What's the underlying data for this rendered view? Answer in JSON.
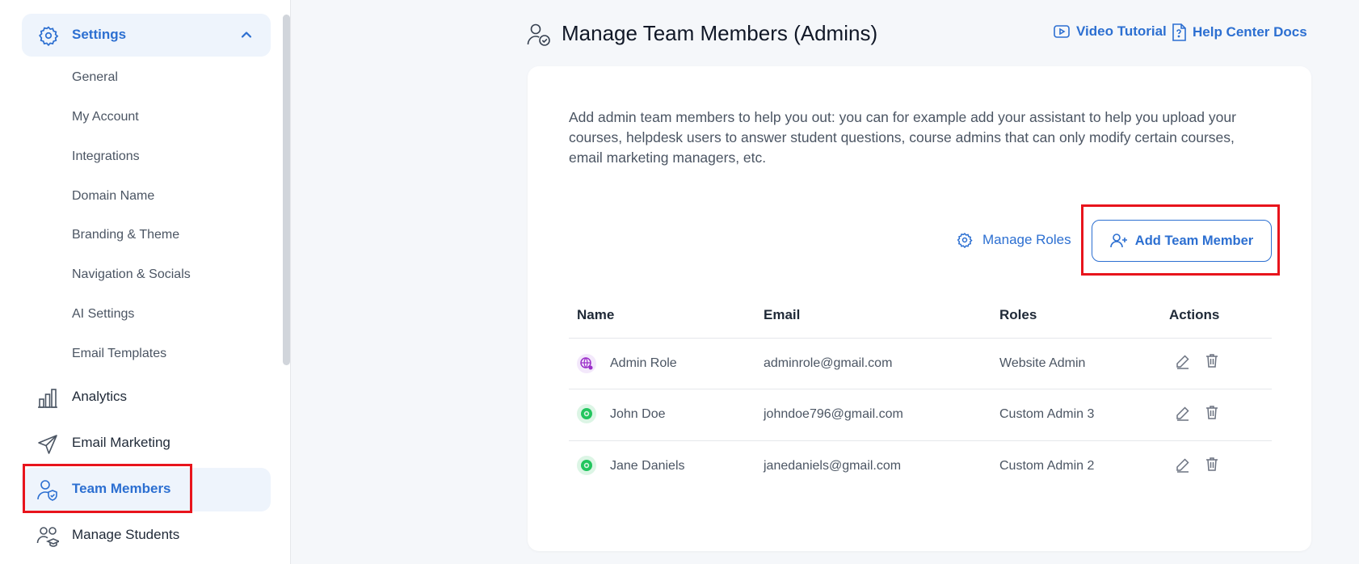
{
  "sidebar": {
    "settings_label": "Settings",
    "sub_items": [
      "General",
      "My Account",
      "Integrations",
      "Domain Name",
      "Branding & Theme",
      "Navigation & Socials",
      "AI Settings",
      "Email Templates"
    ],
    "nav": {
      "analytics": "Analytics",
      "email_marketing": "Email Marketing",
      "team_members": "Team Members",
      "manage_students": "Manage Students"
    }
  },
  "header": {
    "title": "Manage Team Members (Admins)",
    "video_tutorial": "Video Tutorial",
    "help_center": "Help Center Docs"
  },
  "main": {
    "description": "Add admin team members to help you out: you can for example add your assistant to help you upload your courses, helpdesk users to answer student questions, course admins that can only modify certain courses, email marketing managers, etc.",
    "manage_roles": "Manage Roles",
    "add_member": "Add Team Member",
    "columns": {
      "name": "Name",
      "email": "Email",
      "roles": "Roles",
      "actions": "Actions"
    },
    "rows": [
      {
        "name": "Admin Role",
        "email": "adminrole@gmail.com",
        "role": "Website Admin",
        "avatar": "globe-icon"
      },
      {
        "name": "John Doe",
        "email": "johndoe796@gmail.com",
        "role": "Custom Admin 3",
        "avatar": "gear-icon"
      },
      {
        "name": "Jane Daniels",
        "email": "janedaniels@gmail.com",
        "role": "Custom Admin 2",
        "avatar": "gear-icon"
      }
    ]
  },
  "colors": {
    "accent": "#2c6fd1",
    "highlight": "#e8141c",
    "active_bg": "#eef4fc"
  }
}
